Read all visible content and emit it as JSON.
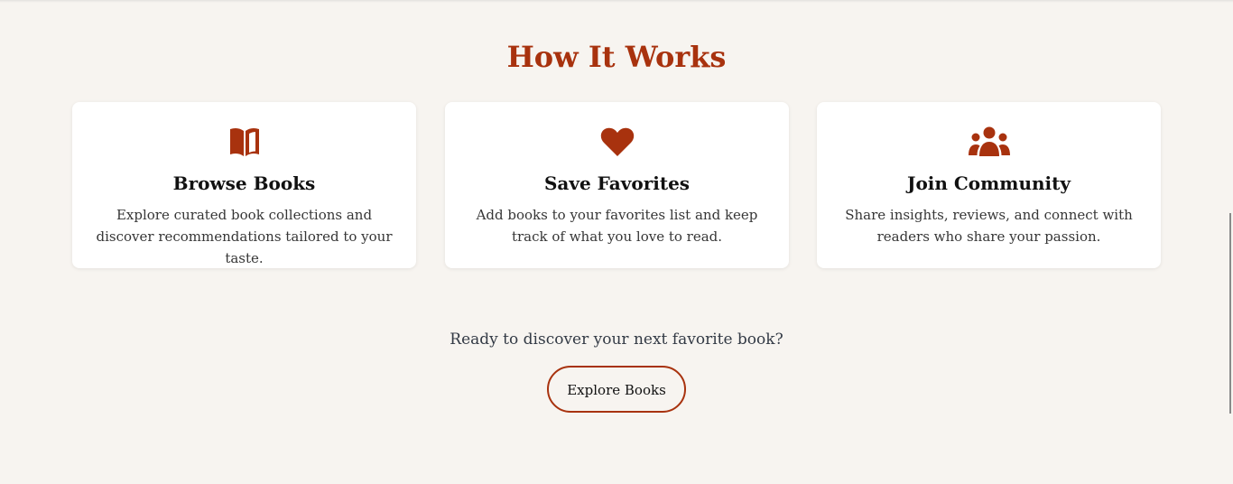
{
  "section": {
    "title": "How It Works"
  },
  "colors": {
    "accent": "#a8320e",
    "background": "#f7f4f0",
    "card": "#ffffff"
  },
  "cards": [
    {
      "icon": "open-book-icon",
      "title": "Browse Books",
      "text": "Explore curated book collections and discover recommendations tailored to your taste."
    },
    {
      "icon": "heart-icon",
      "title": "Save Favorites",
      "text": "Add books to your favorites list and keep track of what you love to read."
    },
    {
      "icon": "users-icon",
      "title": "Join Community",
      "text": "Share insights, reviews, and connect with readers who share your passion."
    }
  ],
  "cta": {
    "text": "Ready to discover your next favorite book?",
    "button_label": "Explore Books"
  }
}
